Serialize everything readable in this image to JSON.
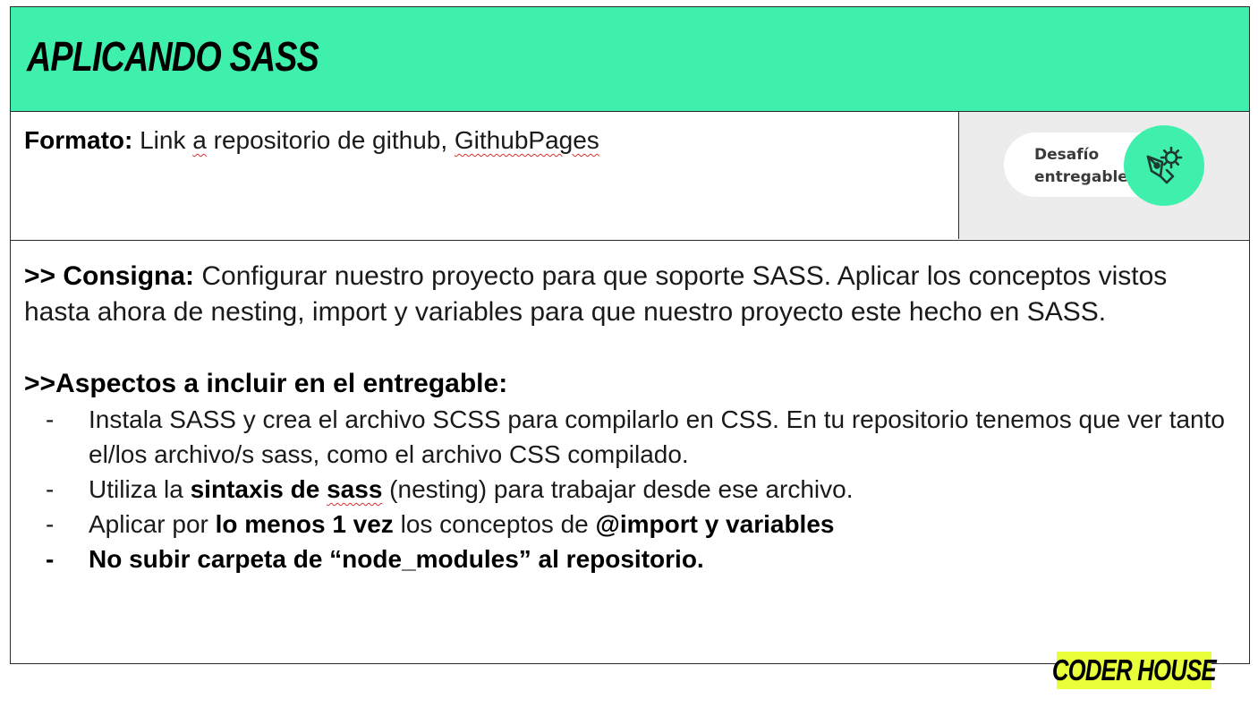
{
  "header": {
    "title": "APLICANDO SASS"
  },
  "format": {
    "label": "Formato:",
    "text_part1": " Link ",
    "text_squiggle1": "a",
    "text_part2": " repositorio de github, ",
    "text_squiggle2": "GithubPages"
  },
  "badge": {
    "line1": "Desafío",
    "line2": "entregable",
    "icon": "pen-gear-icon"
  },
  "consigna": {
    "prefix": ">> Consigna:",
    "text": " Configurar nuestro proyecto para que soporte SASS. Aplicar los conceptos vistos hasta ahora de nesting, import y variables para que nuestro proyecto este hecho en SASS."
  },
  "aspectos": {
    "heading": ">>Aspectos a incluir en el entregable:",
    "item1": "Instala SASS y crea el archivo SCSS para compilarlo en CSS. En tu repositorio tenemos que ver tanto el/los archivo/s sass, como el archivo CSS compilado.",
    "item2": {
      "pre": "Utiliza la ",
      "bold1": "sintaxis de ",
      "bold_squiggle": "sass",
      "post": " (nesting) para trabajar desde ese archivo."
    },
    "item3": {
      "pre": "Aplicar por ",
      "bold1": "lo menos 1 vez",
      "mid": " los conceptos de ",
      "bold2": "@import y variables"
    },
    "item4": "No subir carpeta de “node_modules” al repositorio."
  },
  "footer": {
    "logo_text": "CODER HOUSE"
  },
  "colors": {
    "accent": "#3ff0ad",
    "logo_bg": "#e8ff3a",
    "badge_bg": "#ececec"
  }
}
